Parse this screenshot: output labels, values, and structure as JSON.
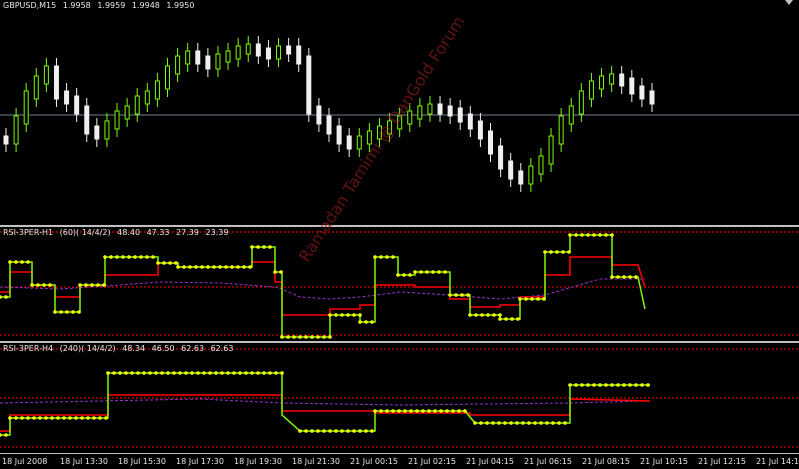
{
  "main_chart": {
    "symbol": "GBPUSD,M15",
    "ohlc": [
      "1.9958",
      "1.9959",
      "1.9948",
      "1.9950"
    ],
    "colors": {
      "bull": "#7CFC00",
      "bear": "#f0f0f0",
      "grid": "#708090"
    }
  },
  "indicator1": {
    "label": "RSI-3PER-H1",
    "params": "(60)( 14/4/2)",
    "values": [
      "48.40",
      "47.33",
      "27.39",
      "23.39"
    ],
    "colors": {
      "rsi": "#7CFC00",
      "rsi_dots": "#ffff00",
      "signal": "#ff0000",
      "avg": "#9932cc",
      "levels": "#ff0000"
    }
  },
  "indicator2": {
    "label": "RSI-3PER-H4",
    "params": "(240)( 14/4/2)",
    "values": [
      "48.34",
      "46.50",
      "62.63",
      "62.63"
    ],
    "colors": {
      "rsi": "#7CFC00",
      "rsi_dots": "#ffff00",
      "signal": "#ff0000",
      "avg": "#9932cc",
      "levels": "#ff0000"
    }
  },
  "time_axis": [
    "18 Jul 2008",
    "18 Jul 13:30",
    "18 Jul 15:30",
    "18 Jul 17:30",
    "18 Jul 19:30",
    "18 Jul 21:30",
    "21 Jul 00:15",
    "21 Jul 02:15",
    "21 Jul 04:15",
    "21 Jul 06:15",
    "21 Jul 08:15",
    "21 Jul 10:15",
    "21 Jul 12:15",
    "21 Jul 14:15"
  ],
  "watermark": "Ramadan Tamimi @ DanGold Forum"
}
